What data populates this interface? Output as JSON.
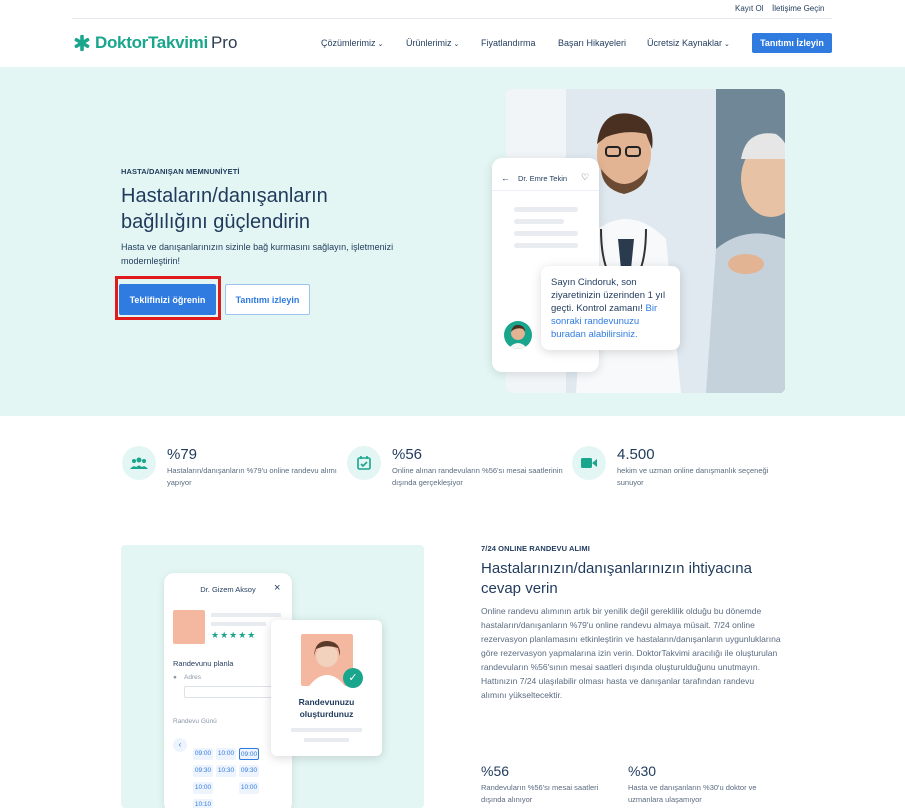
{
  "topbar": {
    "signup": "Kayıt Ol",
    "contact": "İletişime Geçin"
  },
  "nav": {
    "logo_main": "DoktorTakvimi",
    "logo_pro": "Pro",
    "items": [
      {
        "label": "Çözümlerimiz",
        "has_dropdown": true
      },
      {
        "label": "Ürünlerimiz",
        "has_dropdown": true
      },
      {
        "label": "Fiyatlandırma",
        "has_dropdown": false
      },
      {
        "label": "Başarı Hikayeleri",
        "has_dropdown": false
      },
      {
        "label": "Ücretsiz Kaynaklar",
        "has_dropdown": true
      }
    ],
    "cta": "Tanıtımı İzleyin"
  },
  "hero": {
    "eyebrow": "HASTA/DANIŞAN MEMNUNİYETİ",
    "title_line1": "Hastaların/danışanların",
    "title_line2": "bağlılığını güçlendirin",
    "subtitle": "Hasta ve danışanlarınızın sizinle bağ kurmasını sağlayın, işletmenizi modernleştirin!",
    "primary_button": "Teklifinizi öğrenin",
    "secondary_button": "Tanıtımı izleyin",
    "phone_header": "Dr. Emre Tekin",
    "message_line1": "Sayın Cindoruk, son ziyaretinizin üzerinden 1 yıl geçti. Kontrol zamanı!",
    "message_link": "Bir sonraki randevunuzu buradan alabilirsiniz."
  },
  "stats": [
    {
      "icon": "users-icon",
      "value": "%79",
      "text": "Hastaların/danışanların %79'u online randevu alımı yapıyor"
    },
    {
      "icon": "calendar-check-icon",
      "value": "%56",
      "text": "Online alınan randevuların %56'sı mesai saatlerinin dışında gerçekleşiyor"
    },
    {
      "icon": "video-icon",
      "value": "4.500",
      "text": "hekim ve uzman online danışmanlık seçeneği sunuyor"
    }
  ],
  "feature": {
    "eyebrow": "7/24 ONLINE RANDEVU ALIMI",
    "title": "Hastalarınızın/danışanlarınızın ihtiyacına cevap verin",
    "body": "Online randevu alımının artık bir yenilik değil gereklilik olduğu bu dönemde hastaların/danışanların %79'u online randevu almaya müsait. 7/24 online rezervasyon planlamasını etkinleştirin ve hastaların/danışanların uygunluklarına göre rezervasyon yapmalarına izin verin. DoktorTakvimi aracılığı ile oluşturulan randevuların %56'sının mesai saatleri dışında oluşturulduğunu unutmayın. Hattınızın 7/24 ulaşılabilir olması hasta ve danışanlar tarafından randevu alımını yükseltecektir.",
    "mock_doctor": "Dr. Gizem Aksoy",
    "mock_plan": "Randevunu planla",
    "mock_address": "Adres",
    "mock_day": "Randevu Günü",
    "mock_confirm": "Randevunuzu oluşturdunuz",
    "slots": [
      "09:00",
      "10:00",
      "09:00",
      "09:30",
      "10:30",
      "09:30",
      "10:00",
      "10:00",
      "10:10"
    ],
    "bottom_stats": [
      {
        "value": "%56",
        "text": "Randevuların %56'sı mesai saatleri dışında alınıyor"
      },
      {
        "value": "%30",
        "text": "Hasta ve danışanların %30'u doktor ve uzmanlara ulaşamıyor"
      }
    ]
  },
  "colors": {
    "brand_green": "#1aa58d",
    "accent_blue": "#2f7be0",
    "hero_bg": "#e3f6f3",
    "highlight_red": "#e01b1b"
  }
}
